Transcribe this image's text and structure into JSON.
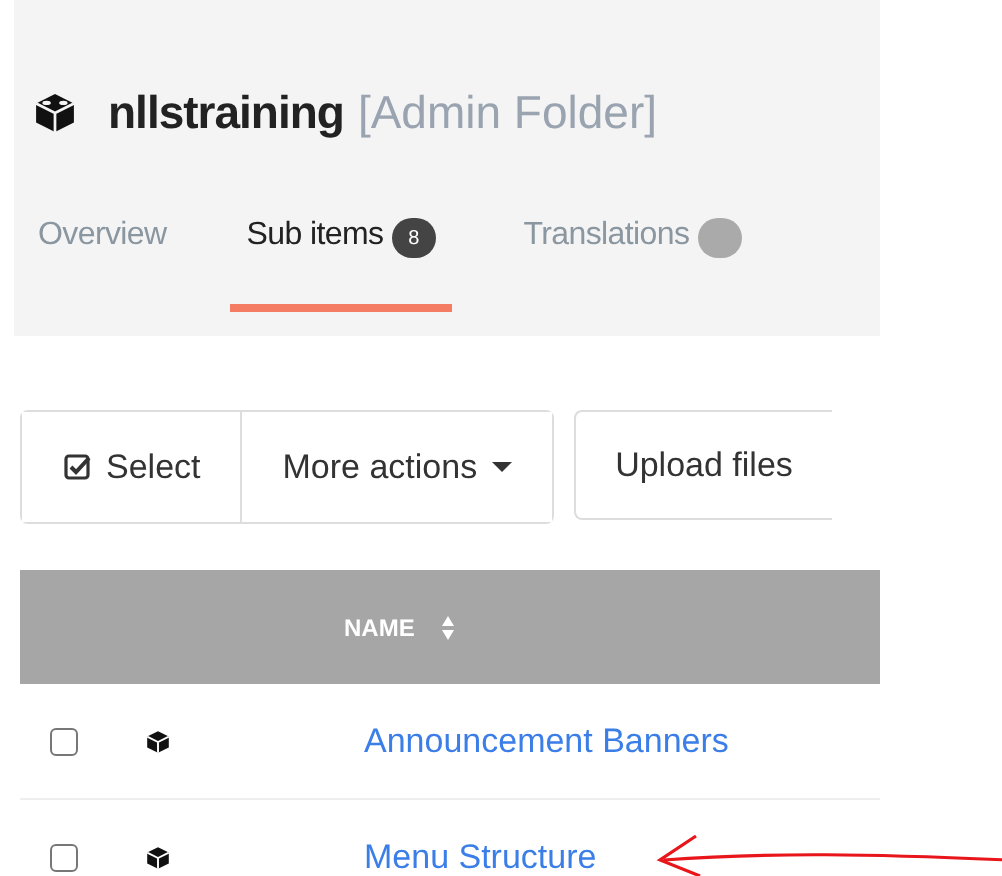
{
  "header": {
    "title": "nllstraining",
    "subtitle": "[Admin Folder]"
  },
  "tabs": [
    {
      "label": "Overview",
      "selected": false
    },
    {
      "label": "Sub items",
      "badge": "8",
      "selected": true
    },
    {
      "label": "Translations",
      "selected": false,
      "badge_cut": true
    }
  ],
  "toolbar": [
    {
      "label": "Select",
      "kind": "select"
    },
    {
      "label": "More actions",
      "kind": "dropdown"
    },
    {
      "label": "Upload files",
      "kind": "plain"
    }
  ],
  "table": {
    "columns": [
      "NAME"
    ],
    "rows": [
      {
        "name": "Announcement Banners",
        "checked": false
      },
      {
        "name": "Menu Structure",
        "checked": false
      }
    ]
  },
  "annotation": {
    "kind": "arrow"
  }
}
